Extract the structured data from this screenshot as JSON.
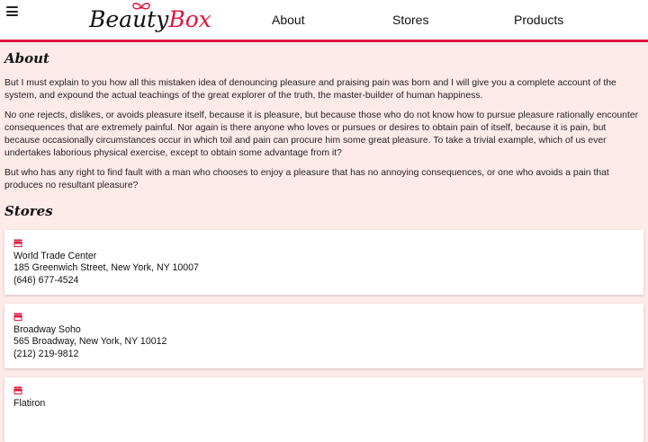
{
  "header": {
    "logo_text_black": "Beauty",
    "logo_text_red": "Box",
    "nav": [
      "About",
      "Stores",
      "Products"
    ]
  },
  "about": {
    "title": "About",
    "paragraphs": [
      "But I must explain to you how all this mistaken idea of denouncing pleasure and praising pain was born and I will give you a complete account of the system, and expound the actual teachings of the great explorer of the truth, the master-builder of human happiness.",
      "No one rejects, dislikes, or avoids pleasure itself, because it is pleasure, but because those who do not know how to pursue pleasure rationally encounter consequences that are extremely painful. Nor again is there anyone who loves or pursues or desires to obtain pain of itself, because it is pain, but because occasionally circumstances occur in which toil and pain can procure him some great pleasure. To take a trivial example, which of us ever undertakes laborious physical exercise, except to obtain some advantage from it?",
      "But who has any right to find fault with a man who chooses to enjoy a pleasure that has no annoying consequences, or one who avoids a pain that produces no resultant pleasure?"
    ]
  },
  "stores": {
    "title": "Stores",
    "items": [
      {
        "name": "World Trade Center",
        "address": "185 Greenwich Street, New York, NY 10007",
        "phone": "(646) 677-4524"
      },
      {
        "name": "Broadway Soho",
        "address": "565 Broadway, New York, NY 10012",
        "phone": "(212) 219-9812"
      },
      {
        "name": "Flatiron",
        "address": "",
        "phone": ""
      }
    ]
  },
  "colors": {
    "accent": "#e0143c",
    "background": "#ffeaea"
  },
  "icons": {
    "menu": "hamburger-icon",
    "store": "store-icon"
  }
}
